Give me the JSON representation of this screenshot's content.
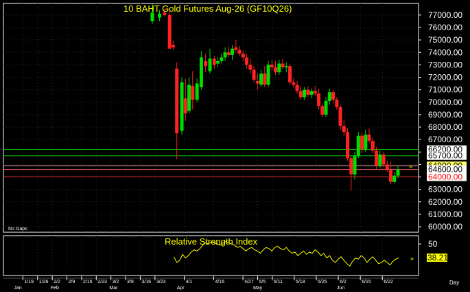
{
  "chart_data": [
    {
      "type": "candlestick",
      "title": "10 BAHT  Gold Futures  Aug-26  (GF10Q26)",
      "footnote": "No Gaps",
      "ylim": [
        60000,
        77600
      ],
      "yticks": [
        60000,
        61000,
        62000,
        63000,
        64000,
        65000,
        66000,
        67000,
        68000,
        69000,
        70000,
        71000,
        72000,
        73000,
        74000,
        75000,
        76000,
        77000
      ],
      "ytick_labels": [
        "60000.00",
        "61000.00",
        "62000.00",
        "63000.00",
        "64000.00",
        "65000.00",
        "66000.00",
        "67000.00",
        "68000.00",
        "69000.00",
        "70000.00",
        "71000.00",
        "72000.00",
        "73000.00",
        "74000.00",
        "75000.00",
        "76000.00",
        "77000.00"
      ],
      "levels": [
        {
          "value": 66200,
          "label": "66200.00",
          "color": "#00cc00",
          "label_bg": "#ffffff",
          "label_color": "#000000"
        },
        {
          "value": 65700,
          "label": "65700.00",
          "color": "#00cc00",
          "label_bg": "#ffffff",
          "label_color": "#000000"
        },
        {
          "value": 64900,
          "label": "64900.00",
          "color": "#ffaaaa",
          "label_bg": "#ffff66",
          "label_color": "#000000"
        },
        {
          "value": 64600,
          "label": "64600.00",
          "color": "#ff6666",
          "label_bg": "#ffffff",
          "label_color": "#000000"
        },
        {
          "value": 64000,
          "label": "64000.00",
          "color": "#ff3333",
          "label_bg": "#ffffff",
          "label_color": "#ff0000"
        }
      ],
      "colors": {
        "up": "#00dd00",
        "down": "#ff2222",
        "grid": "#2a2a2a",
        "title": "#ffff00"
      },
      "candles": [
        {
          "x": 20.0,
          "o": 76500,
          "h": 77900,
          "l": 76300,
          "c": 77200
        },
        {
          "x": 21.0,
          "o": 76800,
          "h": 77400,
          "l": 76500,
          "c": 77100
        },
        {
          "x": 21.7,
          "o": 77200,
          "h": 77500,
          "l": 76900,
          "c": 77000
        },
        {
          "x": 22.4,
          "o": 77000,
          "h": 77500,
          "l": 76300,
          "c": 74300
        },
        {
          "x": 22.9,
          "o": 74600,
          "h": 74900,
          "l": 74200,
          "c": 74400
        },
        {
          "x": 23.4,
          "o": 72700,
          "h": 73200,
          "l": 65400,
          "c": 67500
        },
        {
          "x": 24.1,
          "o": 67700,
          "h": 72000,
          "l": 67400,
          "c": 71600
        },
        {
          "x": 24.6,
          "o": 70300,
          "h": 71900,
          "l": 68500,
          "c": 69100
        },
        {
          "x": 25.1,
          "o": 69300,
          "h": 72000,
          "l": 69100,
          "c": 71400
        },
        {
          "x": 25.6,
          "o": 71300,
          "h": 72500,
          "l": 69400,
          "c": 70200
        },
        {
          "x": 26.2,
          "o": 70200,
          "h": 71900,
          "l": 70000,
          "c": 71500
        },
        {
          "x": 26.8,
          "o": 71200,
          "h": 74100,
          "l": 71000,
          "c": 73600
        },
        {
          "x": 27.4,
          "o": 73300,
          "h": 73900,
          "l": 72400,
          "c": 72900
        },
        {
          "x": 28.0,
          "o": 72500,
          "h": 74300,
          "l": 72300,
          "c": 73500
        },
        {
          "x": 28.6,
          "o": 73500,
          "h": 73700,
          "l": 72700,
          "c": 73000
        },
        {
          "x": 29.1,
          "o": 73100,
          "h": 73600,
          "l": 72800,
          "c": 73300
        },
        {
          "x": 29.6,
          "o": 73300,
          "h": 73900,
          "l": 73100,
          "c": 73600
        },
        {
          "x": 30.1,
          "o": 73600,
          "h": 74400,
          "l": 73300,
          "c": 74000
        },
        {
          "x": 30.6,
          "o": 74000,
          "h": 74500,
          "l": 73600,
          "c": 73800
        },
        {
          "x": 31.1,
          "o": 73800,
          "h": 74600,
          "l": 73400,
          "c": 74300
        },
        {
          "x": 31.6,
          "o": 74400,
          "h": 75000,
          "l": 74000,
          "c": 74200
        },
        {
          "x": 32.1,
          "o": 74200,
          "h": 74500,
          "l": 73700,
          "c": 73900
        },
        {
          "x": 32.6,
          "o": 73900,
          "h": 74100,
          "l": 73300,
          "c": 73600
        },
        {
          "x": 33.1,
          "o": 73600,
          "h": 73900,
          "l": 72700,
          "c": 73000
        },
        {
          "x": 33.6,
          "o": 73000,
          "h": 73500,
          "l": 72300,
          "c": 72600
        },
        {
          "x": 34.1,
          "o": 72600,
          "h": 72900,
          "l": 71600,
          "c": 71800
        },
        {
          "x": 34.6,
          "o": 71700,
          "h": 72300,
          "l": 71000,
          "c": 71500
        },
        {
          "x": 35.1,
          "o": 71400,
          "h": 72600,
          "l": 71200,
          "c": 72300
        },
        {
          "x": 35.6,
          "o": 72300,
          "h": 72900,
          "l": 71200,
          "c": 71400
        },
        {
          "x": 36.1,
          "o": 71400,
          "h": 73300,
          "l": 71200,
          "c": 73000
        },
        {
          "x": 36.6,
          "o": 73000,
          "h": 73400,
          "l": 72500,
          "c": 72800
        },
        {
          "x": 37.1,
          "o": 72800,
          "h": 73300,
          "l": 72200,
          "c": 72400
        },
        {
          "x": 37.6,
          "o": 72400,
          "h": 73400,
          "l": 72200,
          "c": 73100
        },
        {
          "x": 38.1,
          "o": 73100,
          "h": 73500,
          "l": 72600,
          "c": 72800
        },
        {
          "x": 38.6,
          "o": 72800,
          "h": 73200,
          "l": 72400,
          "c": 72900
        },
        {
          "x": 39.1,
          "o": 72900,
          "h": 73100,
          "l": 71400,
          "c": 71600
        },
        {
          "x": 39.6,
          "o": 71600,
          "h": 71900,
          "l": 71200,
          "c": 71400
        },
        {
          "x": 40.1,
          "o": 71400,
          "h": 71700,
          "l": 70700,
          "c": 70900
        },
        {
          "x": 40.6,
          "o": 70900,
          "h": 71300,
          "l": 70200,
          "c": 70400
        },
        {
          "x": 41.1,
          "o": 70400,
          "h": 71200,
          "l": 70200,
          "c": 71000
        },
        {
          "x": 41.6,
          "o": 71000,
          "h": 71300,
          "l": 70400,
          "c": 70600
        },
        {
          "x": 42.1,
          "o": 70600,
          "h": 71100,
          "l": 70300,
          "c": 70900
        },
        {
          "x": 42.6,
          "o": 70900,
          "h": 71300,
          "l": 70500,
          "c": 70700
        },
        {
          "x": 43.1,
          "o": 70700,
          "h": 71100,
          "l": 69400,
          "c": 69700
        },
        {
          "x": 43.6,
          "o": 69700,
          "h": 69900,
          "l": 68800,
          "c": 69000
        },
        {
          "x": 44.1,
          "o": 69000,
          "h": 70400,
          "l": 68800,
          "c": 70100
        },
        {
          "x": 44.6,
          "o": 70100,
          "h": 71100,
          "l": 69800,
          "c": 70800
        },
        {
          "x": 45.1,
          "o": 70800,
          "h": 71000,
          "l": 69900,
          "c": 70200
        },
        {
          "x": 45.6,
          "o": 70200,
          "h": 70400,
          "l": 69400,
          "c": 69600
        },
        {
          "x": 46.1,
          "o": 69600,
          "h": 69800,
          "l": 67800,
          "c": 68100
        },
        {
          "x": 46.6,
          "o": 68100,
          "h": 68600,
          "l": 67300,
          "c": 67600
        },
        {
          "x": 47.1,
          "o": 67600,
          "h": 67900,
          "l": 65300,
          "c": 65500
        },
        {
          "x": 47.6,
          "o": 65500,
          "h": 65700,
          "l": 62900,
          "c": 64200
        },
        {
          "x": 48.1,
          "o": 64200,
          "h": 66000,
          "l": 63800,
          "c": 65700
        },
        {
          "x": 48.6,
          "o": 65700,
          "h": 67600,
          "l": 65500,
          "c": 67300
        },
        {
          "x": 49.1,
          "o": 67300,
          "h": 67600,
          "l": 65900,
          "c": 66200
        },
        {
          "x": 49.6,
          "o": 66200,
          "h": 67800,
          "l": 66000,
          "c": 67400
        },
        {
          "x": 50.1,
          "o": 67400,
          "h": 67900,
          "l": 66700,
          "c": 66900
        },
        {
          "x": 50.6,
          "o": 66900,
          "h": 67200,
          "l": 65900,
          "c": 66100
        },
        {
          "x": 51.1,
          "o": 66100,
          "h": 66400,
          "l": 64600,
          "c": 64900
        },
        {
          "x": 51.6,
          "o": 64900,
          "h": 66100,
          "l": 64700,
          "c": 65800
        },
        {
          "x": 52.1,
          "o": 65800,
          "h": 66000,
          "l": 64800,
          "c": 65000
        },
        {
          "x": 52.6,
          "o": 65000,
          "h": 65300,
          "l": 64400,
          "c": 64600
        },
        {
          "x": 53.1,
          "o": 64600,
          "h": 65200,
          "l": 63400,
          "c": 63600
        },
        {
          "x": 53.6,
          "o": 63600,
          "h": 64400,
          "l": 63500,
          "c": 64100
        },
        {
          "x": 54.1,
          "o": 64100,
          "h": 64900,
          "l": 63900,
          "c": 64600
        }
      ]
    },
    {
      "type": "line",
      "title": "Relative Strength Index",
      "ylim": [
        24,
        56
      ],
      "yticks": [
        50
      ],
      "ytick_labels": [
        "50"
      ],
      "last_value": 38.21,
      "last_label": "38.21",
      "colors": {
        "line": "#ffff00"
      },
      "x": [
        23.0,
        23.4,
        23.8,
        24.2,
        24.6,
        25.0,
        25.4,
        25.8,
        26.2,
        26.6,
        27.0,
        27.4,
        27.8,
        28.2,
        28.6,
        29.0,
        29.4,
        29.8,
        30.2,
        30.6,
        31.0,
        31.4,
        31.8,
        32.2,
        32.6,
        33.0,
        33.4,
        33.8,
        34.2,
        34.6,
        35.0,
        35.4,
        35.8,
        36.2,
        36.6,
        37.0,
        37.4,
        37.8,
        38.2,
        38.6,
        39.0,
        39.4,
        39.8,
        40.2,
        40.6,
        41.0,
        41.4,
        41.8,
        42.2,
        42.6,
        43.0,
        43.4,
        43.8,
        44.2,
        44.6,
        45.0,
        45.4,
        45.8,
        46.2,
        46.6,
        47.0,
        47.4,
        47.8,
        48.2,
        48.6,
        49.0,
        49.4,
        49.8,
        50.2,
        50.6,
        51.0,
        51.4,
        51.8,
        52.2,
        52.6,
        53.0,
        53.4,
        53.8,
        54.2
      ],
      "values": [
        39,
        34,
        36,
        41,
        38,
        40,
        43,
        45,
        44,
        46,
        49,
        51,
        50,
        52,
        51,
        50,
        49,
        51,
        52,
        51,
        50,
        49,
        47,
        48,
        46,
        44,
        46,
        47,
        45,
        44,
        42,
        45,
        47,
        46,
        44,
        47,
        48,
        46,
        45,
        47,
        44,
        42,
        43,
        40,
        42,
        44,
        41,
        43,
        42,
        45,
        43,
        40,
        42,
        38,
        40,
        36,
        34,
        37,
        39,
        36,
        33,
        31,
        35,
        38,
        37,
        40,
        38,
        34,
        37,
        39,
        36,
        33,
        34,
        36,
        34,
        32,
        35,
        37,
        38
      ]
    }
  ],
  "x_axis": {
    "date_labels": [
      {
        "x": 1,
        "text": "1/19"
      },
      {
        "x": 2,
        "text": "1/26"
      },
      {
        "x": 3,
        "text": "2/2"
      },
      {
        "x": 4,
        "text": "2/9"
      },
      {
        "x": 5,
        "text": "2/16"
      },
      {
        "x": 6,
        "text": "2/23"
      },
      {
        "x": 7,
        "text": "3/2"
      },
      {
        "x": 8,
        "text": "3/9"
      },
      {
        "x": 9,
        "text": "3/16"
      },
      {
        "x": 10,
        "text": "3/23"
      },
      {
        "x": 12,
        "text": "4/1"
      },
      {
        "x": 14,
        "text": "4/16"
      },
      {
        "x": 16,
        "text": "4/27"
      },
      {
        "x": 17,
        "text": "5/5"
      },
      {
        "x": 18,
        "text": "5/11"
      },
      {
        "x": 19.5,
        "text": "5/18"
      },
      {
        "x": 21,
        "text": "5/25"
      },
      {
        "x": 22.5,
        "text": "6/2"
      },
      {
        "x": 24,
        "text": "6/15"
      },
      {
        "x": 25.5,
        "text": "6/22"
      }
    ],
    "month_labels": [
      {
        "x": 0.3,
        "text": "Jan"
      },
      {
        "x": 2.8,
        "text": "Feb"
      },
      {
        "x": 6.8,
        "text": "Mar"
      },
      {
        "x": 11.4,
        "text": "Apr"
      },
      {
        "x": 16.6,
        "text": "May"
      },
      {
        "x": 22.3,
        "text": "Jun"
      }
    ],
    "unit_label": "Day"
  }
}
